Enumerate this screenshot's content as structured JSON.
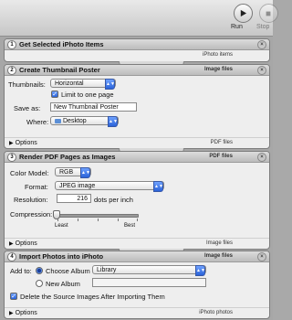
{
  "toolbar": {
    "run_label": "Run",
    "stop_label": "Stop"
  },
  "actions": [
    {
      "number": "1",
      "title": "Get Selected iPhoto Items",
      "output_type": "iPhoto items"
    },
    {
      "number": "2",
      "title": "Create Thumbnail Poster",
      "input_type": "Image files",
      "thumbnails_label": "Thumbnails:",
      "thumbnails_value": "Horizontal",
      "limit_label": "Limit to one page",
      "limit_checked": true,
      "save_as_label": "Save as:",
      "save_as_value": "New Thumbnail Poster",
      "where_label": "Where:",
      "where_value": "Desktop",
      "options_label": "Options",
      "output_type": "PDF files"
    },
    {
      "number": "3",
      "title": "Render PDF Pages as Images",
      "input_type": "PDF files",
      "color_model_label": "Color Model:",
      "color_model_value": "RGB",
      "format_label": "Format:",
      "format_value": "JPEG image",
      "resolution_label": "Resolution:",
      "resolution_value": "216",
      "resolution_unit": "dots per inch",
      "compression_label": "Compression:",
      "compression_min": "Least",
      "compression_max": "Best",
      "compression_level": 0,
      "options_label": "Options",
      "output_type": "Image files"
    },
    {
      "number": "4",
      "title": "Import Photos into iPhoto",
      "input_type": "Image files",
      "add_to_label": "Add to:",
      "choose_album_label": "Choose Album",
      "album_value": "Library",
      "new_album_label": "New Album",
      "delete_label": "Delete the Source Images After Importing Them",
      "delete_checked": true,
      "options_label": "Options",
      "output_type": "iPhoto photos"
    }
  ]
}
